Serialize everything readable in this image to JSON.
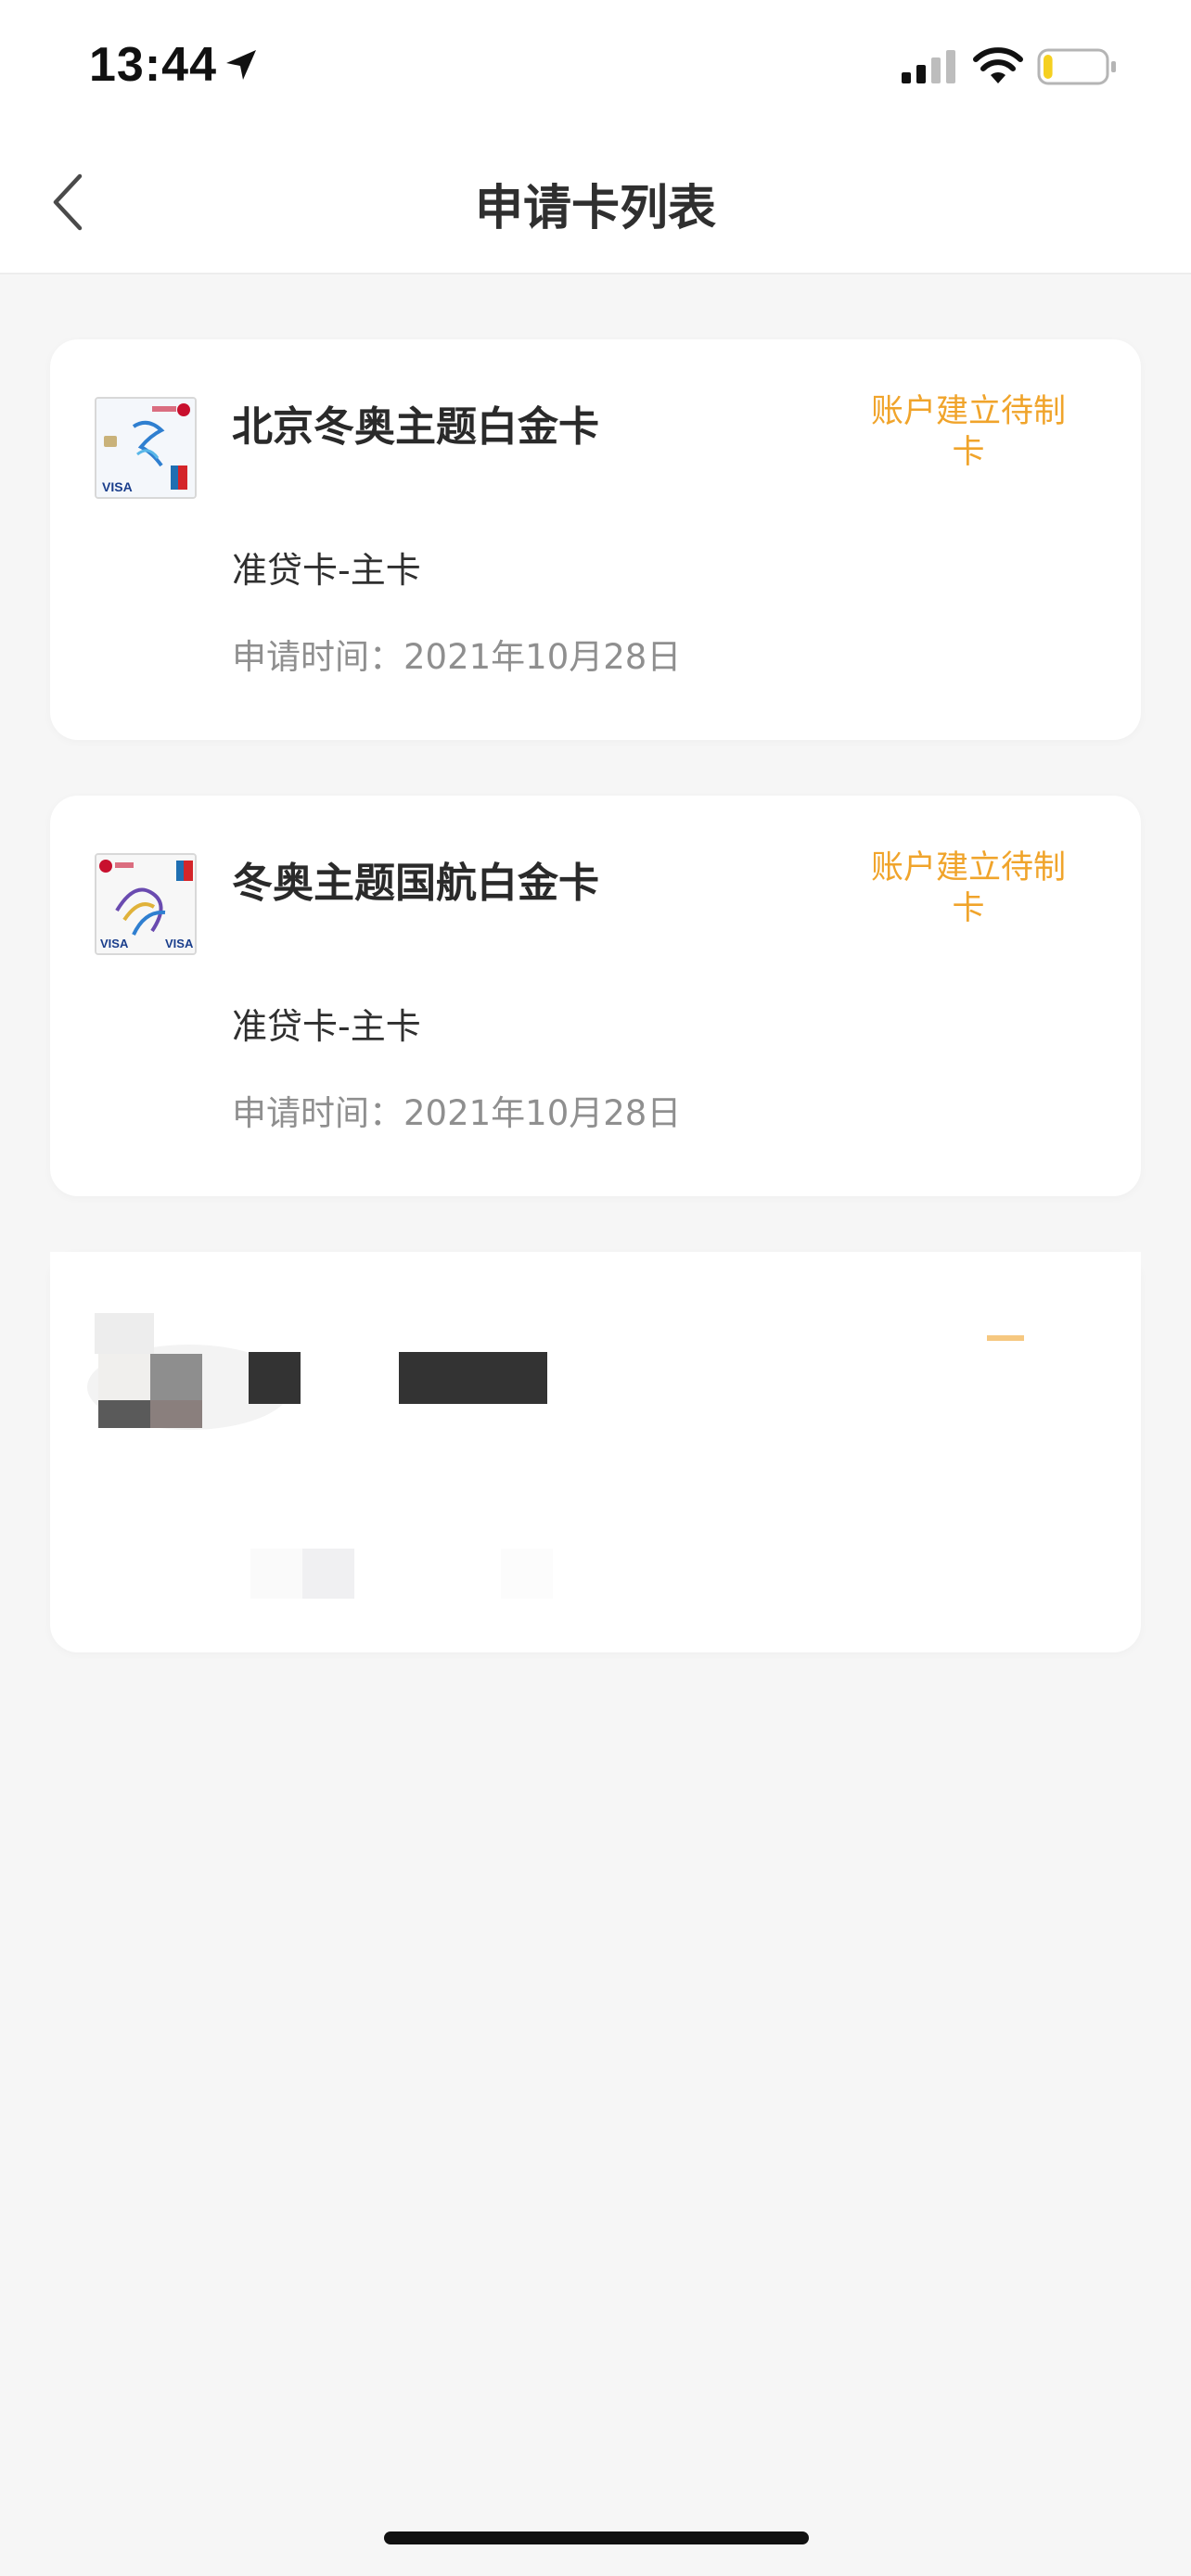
{
  "status_bar": {
    "time": "13:44",
    "icons": [
      "location-arrow-icon",
      "signal-icon",
      "wifi-icon",
      "battery-icon"
    ],
    "battery_level": 0.15,
    "battery_color": "#f5d020"
  },
  "nav": {
    "title": "申请卡列表",
    "back_icon": "chevron-left-icon"
  },
  "colors": {
    "status_accent": "#f0a42b",
    "background": "#f6f6f6",
    "card_background": "#ffffff"
  },
  "cards": [
    {
      "name": "北京冬奥主题白金卡",
      "status": "账户建立待制卡",
      "type": "准贷卡-主卡",
      "date_label": "申请时间：",
      "date": "2021年10月28日"
    },
    {
      "name": "冬奥主题国航白金卡",
      "status": "账户建立待制卡",
      "type": "准贷卡-主卡",
      "date_label": "申请时间：",
      "date": "2021年10月28日"
    },
    {
      "redacted": true
    }
  ]
}
